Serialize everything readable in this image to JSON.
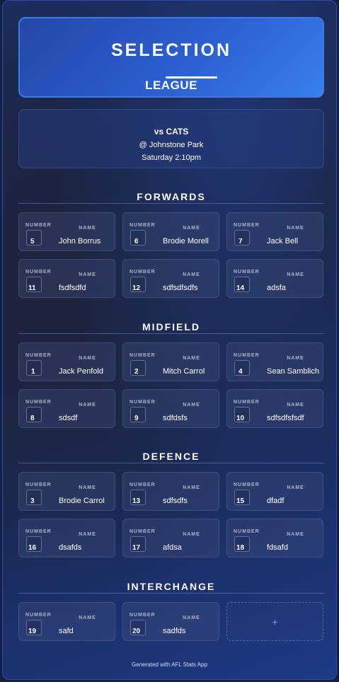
{
  "header": {
    "title": "SELECTION",
    "subtitle": "LEAGUE"
  },
  "match": {
    "opponent": "vs CATS",
    "venue": "@ Johnstone Park",
    "time": "Saturday 2:10pm"
  },
  "labels": {
    "number": "NUMBER",
    "name": "NAME"
  },
  "sections": {
    "forwards": {
      "title": "FORWARDS",
      "players": [
        {
          "number": "5",
          "name": "John Borrus"
        },
        {
          "number": "6",
          "name": "Brodie Morell"
        },
        {
          "number": "7",
          "name": "Jack Bell"
        },
        {
          "number": "11",
          "name": "fsdfsdfd"
        },
        {
          "number": "12",
          "name": "sdfsdfsdfs"
        },
        {
          "number": "14",
          "name": "adsfa"
        }
      ]
    },
    "midfield": {
      "title": "MIDFIELD",
      "players": [
        {
          "number": "1",
          "name": "Jack Penfold"
        },
        {
          "number": "2",
          "name": "Mitch Carrol"
        },
        {
          "number": "4",
          "name": "Sean Samblich"
        },
        {
          "number": "8",
          "name": "sdsdf"
        },
        {
          "number": "9",
          "name": "sdfdsfs"
        },
        {
          "number": "10",
          "name": "sdfsdfsfsdf"
        }
      ]
    },
    "defence": {
      "title": "DEFENCE",
      "players": [
        {
          "number": "3",
          "name": "Brodie Carrol"
        },
        {
          "number": "13",
          "name": "sdfsdfs"
        },
        {
          "number": "15",
          "name": "dfadf"
        },
        {
          "number": "16",
          "name": "dsafds"
        },
        {
          "number": "17",
          "name": "afdsa"
        },
        {
          "number": "18",
          "name": "fdsafd"
        }
      ]
    },
    "interchange": {
      "title": "INTERCHANGE",
      "players": [
        {
          "number": "19",
          "name": "safd"
        },
        {
          "number": "20",
          "name": "sadfds"
        }
      ],
      "add_symbol": "+"
    }
  },
  "footer": "Generated with AFL Stats App"
}
